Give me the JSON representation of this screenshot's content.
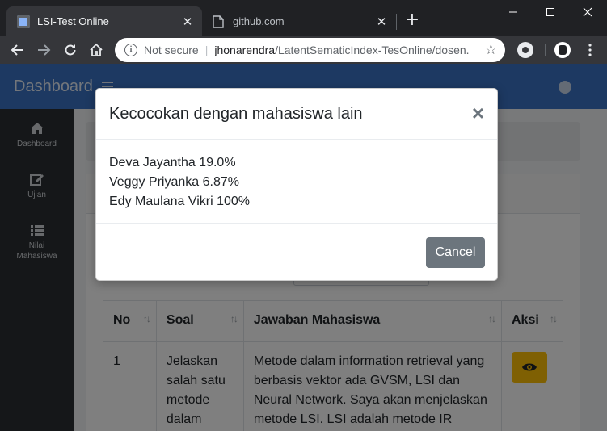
{
  "browser": {
    "tabs": [
      {
        "title": "LSI-Test Online",
        "close": "✕"
      },
      {
        "title": "github.com",
        "close": "✕"
      }
    ],
    "new_tab": "+",
    "address": {
      "security_label": "Not secure",
      "url_host": "jhonarendra",
      "url_path": "/LatentSematicIndex-TesOnline/dosen..."
    }
  },
  "app": {
    "brand": "Dashboard",
    "sidebar": [
      {
        "label": "Dashboard",
        "icon": "home-icon"
      },
      {
        "label": "Ujian",
        "icon": "edit-icon"
      },
      {
        "label": "Nilai Mahasiswa",
        "icon": "list-icon"
      }
    ],
    "table": {
      "headers": [
        "No",
        "Soal",
        "Jawaban Mahasiswa",
        "Aksi"
      ],
      "sort_glyph": "↑↓",
      "rows": [
        {
          "no": "1",
          "soal": "Jelaskan salah satu metode dalam",
          "jawaban": "Metode dalam information retrieval yang berbasis vektor ada GVSM, LSI dan Neural Network. Saya akan menjelaskan metode LSI. LSI adalah metode IR"
        }
      ]
    }
  },
  "modal": {
    "title": "Kecocokan dengan mahasiswa lain",
    "close": "×",
    "matches": [
      "Deva Jayantha 19.0%",
      "Veggy Priyanka 6.87%",
      "Edy Maulana Vikri 100%"
    ],
    "cancel_label": "Cancel"
  },
  "colors": {
    "header": "#3b73c4",
    "sidebar": "#2b2f33",
    "action_button": "#ffc107",
    "cancel_button": "#6c757d"
  }
}
